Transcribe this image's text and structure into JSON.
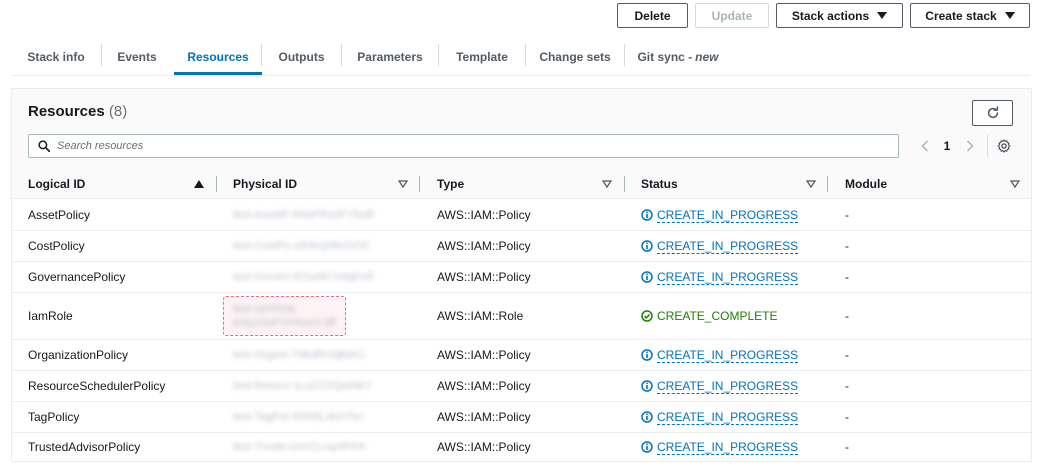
{
  "actions": {
    "delete": "Delete",
    "update": "Update",
    "stack_actions": "Stack actions",
    "create_stack": "Create stack"
  },
  "tabs": [
    {
      "label": "Stack info"
    },
    {
      "label": "Events"
    },
    {
      "label": "Resources",
      "active": true
    },
    {
      "label": "Outputs"
    },
    {
      "label": "Parameters"
    },
    {
      "label": "Template"
    },
    {
      "label": "Change sets"
    },
    {
      "label": "Git sync",
      "suffix": "new"
    }
  ],
  "panel": {
    "title": "Resources",
    "count": "(8)",
    "search_placeholder": "Search resources",
    "pager": {
      "prev": "<",
      "current": "1",
      "next": ">"
    }
  },
  "columns": {
    "logical_id": "Logical ID",
    "physical_id": "Physical ID",
    "type": "Type",
    "status": "Status",
    "module": "Module"
  },
  "rows": [
    {
      "logical_id": "AssetPolicy",
      "physical_id": "test-AssetP-9NsPRo0FY5uB",
      "type": "AWS::IAM::Policy",
      "status": "CREATE_IN_PROGRESS",
      "module": "-"
    },
    {
      "logical_id": "CostPolicy",
      "physical_id": "test-CostPo-a5nkQMkrGOZ",
      "type": "AWS::IAM::Policy",
      "status": "CREATE_IN_PROGRESS",
      "module": "-"
    },
    {
      "logical_id": "GovernancePolicy",
      "physical_id": "test-Govern-EGuMCVdqEnR",
      "type": "AWS::IAM::Policy",
      "status": "CREATE_IN_PROGRESS",
      "module": "-"
    },
    {
      "logical_id": "IamRole",
      "physical_id": "test-IamRole",
      "physical_id_2": "kr5p1SeFVHhvmf-3ff",
      "type": "AWS::IAM::Role",
      "status": "CREATE_COMPLETE",
      "module": "-"
    },
    {
      "logical_id": "OrganizationPolicy",
      "physical_id": "test-Organi-7NkdRn0jBdrU",
      "type": "AWS::IAM::Policy",
      "status": "CREATE_IN_PROGRESS",
      "module": "-"
    },
    {
      "logical_id": "ResourceSchedulerPolicy",
      "physical_id": "test-Resour-1LsZCDQaiNkY",
      "type": "AWS::IAM::Policy",
      "status": "CREATE_IN_PROGRESS",
      "module": "-"
    },
    {
      "logical_id": "TagPolicy",
      "physical_id": "test-TagPol-IDtN5Lxk4Yhn",
      "type": "AWS::IAM::Policy",
      "status": "CREATE_IN_PROGRESS",
      "module": "-"
    },
    {
      "logical_id": "TrustedAdvisorPolicy",
      "physical_id": "test-Truste-UvnCLuqnIPKK",
      "type": "AWS::IAM::Policy",
      "status": "CREATE_IN_PROGRESS",
      "module": "-"
    }
  ],
  "colors": {
    "link_blue": "#0073bb",
    "success_green": "#1d8102",
    "text": "#16191f",
    "muted": "#687078"
  }
}
